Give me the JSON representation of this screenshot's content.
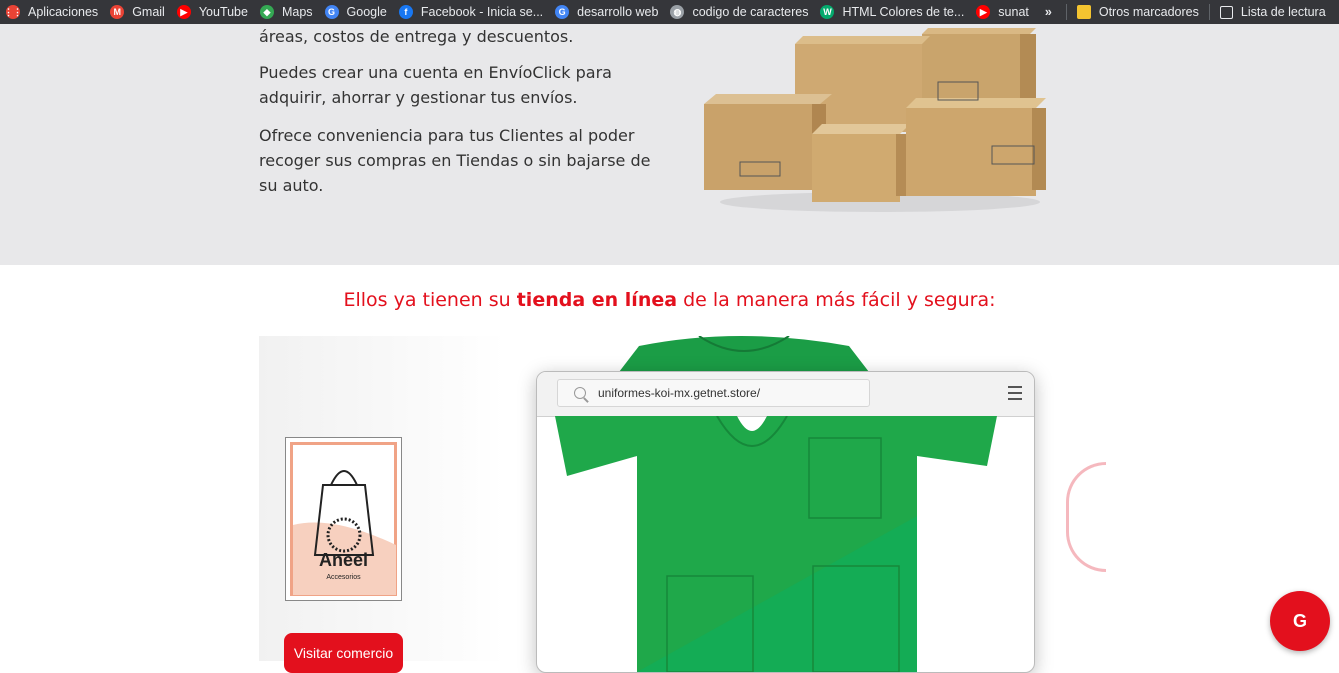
{
  "bookmarks": [
    {
      "label": "Aplicaciones",
      "icon": "apps-grid-icon",
      "color": "#ea4335"
    },
    {
      "label": "Gmail",
      "icon": "gmail-icon",
      "color": "#ea4335"
    },
    {
      "label": "YouTube",
      "icon": "youtube-icon",
      "color": "#ff0000"
    },
    {
      "label": "Maps",
      "icon": "maps-icon",
      "color": "#34a853"
    },
    {
      "label": "Google",
      "icon": "google-icon",
      "color": "#4285f4"
    },
    {
      "label": "Facebook - Inicia se...",
      "icon": "facebook-icon",
      "color": "#1877f2"
    },
    {
      "label": "desarrollo web",
      "icon": "google-icon",
      "color": "#4285f4"
    },
    {
      "label": "codigo de caracteres",
      "icon": "globe-icon",
      "color": "#9aa0a6"
    },
    {
      "label": "HTML Colores de te...",
      "icon": "w3-icon",
      "color": "#04aa6d"
    },
    {
      "label": "sunat",
      "icon": "youtube-icon",
      "color": "#ff0000"
    }
  ],
  "bookmarks_more": "»",
  "other_bookmarks": "Otros marcadores",
  "reading_list": "Lista de lectura",
  "intro": {
    "line_cut": "áreas, costos de entrega y descuentos.",
    "para2": "Puedes crear una cuenta en EnvíoClick para adquirir, ahorrar y gestionar tus envíos.",
    "para3": "Ofrece conveniencia para tus Clientes al poder recoger sus compras en Tiendas o sin bajarse de su auto."
  },
  "headline": {
    "pre": "Ellos ya tienen su ",
    "bold": "tienda en línea",
    "post": " de la manera más fácil y segura:"
  },
  "store_logo": {
    "name": "Aneel",
    "sub": "Accesorios"
  },
  "visit_button": "Visitar comercio",
  "browser": {
    "url": "uniformes-koi-mx.getnet.store/"
  },
  "fab_label": "G",
  "colors": {
    "brand_red": "#e3101d",
    "scrub_green": "#1fa84a",
    "bookmark_bar": "#35363a"
  }
}
